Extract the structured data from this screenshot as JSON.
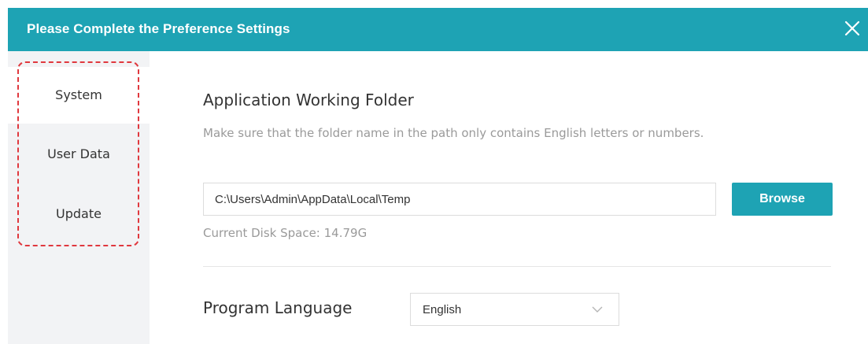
{
  "window": {
    "title": "Please Complete the Preference Settings",
    "close_icon": "close-icon"
  },
  "colors": {
    "accent": "#1ea3b4",
    "highlight_dash": "#e0383e"
  },
  "sidebar": {
    "items": [
      {
        "label": "System",
        "active": true
      },
      {
        "label": "User Data",
        "active": false
      },
      {
        "label": "Update",
        "active": false
      }
    ]
  },
  "working_folder": {
    "title": "Application Working Folder",
    "hint": "Make sure that the folder name in the path only contains English letters or numbers.",
    "path_value": "C:\\Users\\Admin\\AppData\\Local\\Temp",
    "browse_label": "Browse",
    "disk_space": "Current Disk Space: 14.79G"
  },
  "language": {
    "label": "Program Language",
    "selected": "English",
    "dropdown_icon": "chevron-down-icon"
  }
}
